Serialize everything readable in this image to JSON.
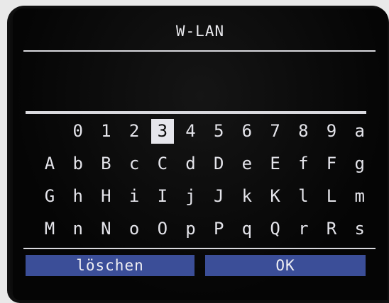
{
  "screen": {
    "title": "W-LAN"
  },
  "keyboard": {
    "selected": "3",
    "rows": [
      [
        "",
        "0",
        "1",
        "2",
        "3",
        "4",
        "5",
        "6",
        "7",
        "8",
        "9",
        "a"
      ],
      [
        "A",
        "b",
        "B",
        "c",
        "C",
        "d",
        "D",
        "e",
        "E",
        "f",
        "F",
        "g"
      ],
      [
        "G",
        "h",
        "H",
        "i",
        "I",
        "j",
        "J",
        "k",
        "K",
        "l",
        "L",
        "m"
      ],
      [
        "M",
        "n",
        "N",
        "o",
        "O",
        "p",
        "P",
        "q",
        "Q",
        "r",
        "R",
        "s"
      ]
    ]
  },
  "buttons": {
    "delete_label": "löschen",
    "ok_label": "OK"
  },
  "colors": {
    "button_bg": "#3b4e98",
    "text": "#e4e4ea",
    "selection_bg": "#e6e6ec"
  }
}
